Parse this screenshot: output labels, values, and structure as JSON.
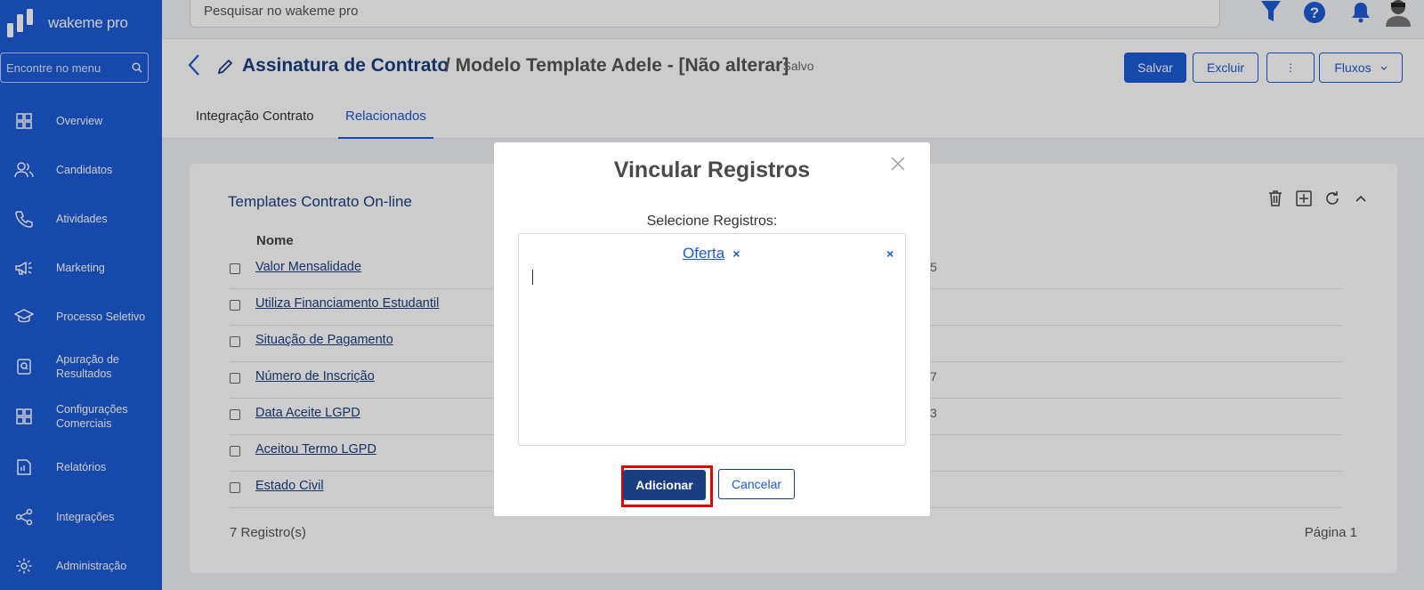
{
  "app": {
    "logo_text": "wakeme pro"
  },
  "sidebar": {
    "search_placeholder": "Encontre no menu",
    "items": [
      {
        "label": "Overview",
        "icon": "grid-icon"
      },
      {
        "label": "Candidatos",
        "icon": "users-icon"
      },
      {
        "label": "Atividades",
        "icon": "phone-icon"
      },
      {
        "label": "Marketing",
        "icon": "megaphone-icon"
      },
      {
        "label": "Processo Seletivo",
        "icon": "graduation-cap-icon"
      },
      {
        "label": "Apuração de Resultados",
        "icon": "search-document-icon"
      },
      {
        "label": "Configurações Comerciais",
        "icon": "grid-icon"
      },
      {
        "label": "Relatórios",
        "icon": "report-icon"
      },
      {
        "label": "Integrações",
        "icon": "share-icon"
      },
      {
        "label": "Administração",
        "icon": "gear-icon"
      }
    ]
  },
  "topbar": {
    "search_placeholder": "Pesquisar no wakeme pro",
    "icons": [
      "filter-icon",
      "help-icon",
      "bell-icon",
      "avatar"
    ]
  },
  "header": {
    "title": "Assinatura de Contrato",
    "subtitle": "/ Modelo Template Adele - [Não alterar]",
    "status": "- Salvo",
    "buttons": {
      "save": "Salvar",
      "delete": "Excluir",
      "more": "⋮",
      "flows": "Fluxos"
    },
    "tabs": [
      {
        "label": "Integração Contrato",
        "active": false
      },
      {
        "label": "Relacionados",
        "active": true
      }
    ]
  },
  "card": {
    "title": "Templates Contrato On-line",
    "column_header": "Nome",
    "rows": [
      {
        "name": "Valor Mensalidade",
        "extra": "5"
      },
      {
        "name": "Utiliza Financiamento Estudantil",
        "extra": ""
      },
      {
        "name": "Situação de Pagamento",
        "extra": ""
      },
      {
        "name": "Número de Inscrição",
        "extra": "7"
      },
      {
        "name": "Data Aceite LGPD",
        "extra": "3"
      },
      {
        "name": "Aceitou Termo LGPD",
        "extra": ""
      },
      {
        "name": "Estado Civil",
        "extra": ""
      }
    ],
    "records": "7 Registro(s)",
    "page": "Página 1",
    "tools": [
      "trash-icon",
      "add-box-icon",
      "refresh-icon",
      "chevron-up-icon"
    ]
  },
  "modal": {
    "title": "Vincular Registros",
    "label": "Selecione Registros:",
    "selected_tag": "Oferta",
    "tag_remove": "×",
    "clear_all": "×",
    "add_button": "Adicionar",
    "cancel_button": "Cancelar"
  },
  "colors": {
    "sidebar": "#1d5ad6",
    "primary": "#1d5ad6",
    "navy": "#1a3f80",
    "highlight": "#e60000"
  }
}
